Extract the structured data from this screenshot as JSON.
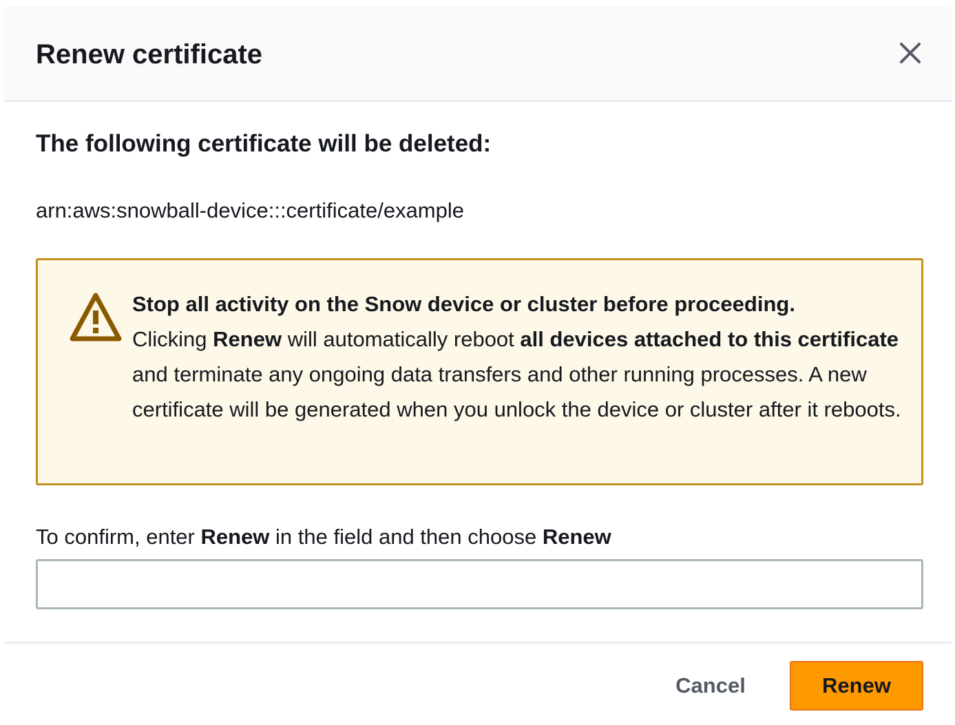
{
  "modal": {
    "title": "Renew certificate",
    "close_icon": "close-icon"
  },
  "content": {
    "heading": "The following certificate will be deleted:",
    "arn": "arn:aws:snowball-device:::certificate/example"
  },
  "alert": {
    "icon": "warning-icon",
    "colors": {
      "background": "#fef8e8",
      "border": "#bf9020",
      "icon": "#8a5a00"
    },
    "strong_intro": "Stop all activity on the Snow device or cluster before proceeding.",
    "text_clicking": "Clicking",
    "text_renew": "Renew",
    "text_will_reboot": "will automatically reboot",
    "text_all_devices": "all devices attached to this certificate",
    "text_rest": "and terminate any ongoing data transfers and other running processes. A new certificate will be generated when you unlock the device or cluster after it reboots."
  },
  "confirm": {
    "label_part1": "To confirm, enter",
    "label_keyword": "Renew",
    "label_part2": "in the field and then choose",
    "label_action": "Renew",
    "input_value": "",
    "input_placeholder": ""
  },
  "footer": {
    "cancel_label": "Cancel",
    "renew_label": "Renew",
    "colors": {
      "primary": "#ff9900"
    }
  }
}
